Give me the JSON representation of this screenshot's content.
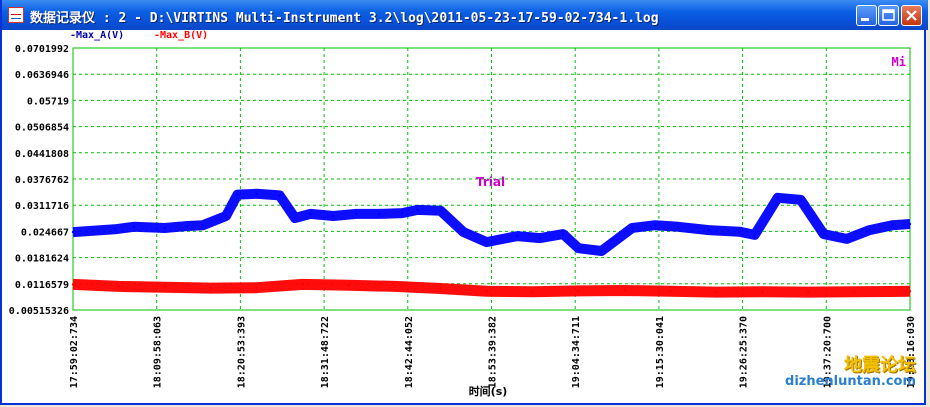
{
  "window": {
    "title": "数据记录仪 : 2 - D:\\VIRTINS Multi-Instrument 3.2\\log\\2011-05-23-17-59-02-734-1.log",
    "controls": [
      "minimize",
      "maximize",
      "close"
    ]
  },
  "legend": {
    "series_a": "-Max_A(V)",
    "series_b": "-Max_B(V)"
  },
  "plot": {
    "corner_label": "Mi",
    "trial_label": "Trial",
    "xlabel": "时间(s)",
    "background": "#ffffff",
    "grid_color": "#00c000",
    "series_a_color": "#0000ff",
    "series_b_color": "#ff0000"
  },
  "watermark": {
    "text": "地震论坛",
    "url": "dizhenluntan.com"
  },
  "chart_data": {
    "type": "line",
    "xlabel": "时间(s)",
    "ylabel": "",
    "grid": true,
    "legend_position": "top-left",
    "y_ticks": [
      "0.0701992",
      "0.0636946",
      "0.05719",
      "0.0506854",
      "0.0441808",
      "0.0376762",
      "0.0311716",
      "0.024667",
      "0.0181624",
      "0.0116579",
      "0.00515326"
    ],
    "x_ticks": [
      "17:59:02:734",
      "18:09:58:063",
      "18:20:53:393",
      "18:31:48:722",
      "18:42:44:052",
      "18:53:39:382",
      "19:04:34:711",
      "19:15:30:041",
      "19:26:25:370",
      "19:37:20:700",
      "19:48:16:030"
    ],
    "ylim": [
      0.00515326,
      0.0701992
    ],
    "x_range": [
      "17:59:02:734",
      "19:48:16:030"
    ],
    "series": [
      {
        "name": "-Max_A(V)",
        "color": "#0000ff",
        "x": [
          "17:59:02",
          "18:04:30",
          "18:07:00",
          "18:11:00",
          "18:14:00",
          "18:16:00",
          "18:19:00",
          "18:20:30",
          "18:23:00",
          "18:26:00",
          "18:28:00",
          "18:30:00",
          "18:33:00",
          "18:36:00",
          "18:39:00",
          "18:42:00",
          "18:44:00",
          "18:47:00",
          "18:50:00",
          "18:53:00",
          "18:57:00",
          "19:00:00",
          "19:03:00",
          "19:05:00",
          "19:08:00",
          "19:12:00",
          "19:15:00",
          "19:18:00",
          "19:22:00",
          "19:26:00",
          "19:28:00",
          "19:31:00",
          "19:34:00",
          "19:37:00",
          "19:40:00",
          "19:43:00",
          "19:46:00",
          "19:48:16"
        ],
        "values": [
          0.0245,
          0.0252,
          0.0258,
          0.0255,
          0.026,
          0.0262,
          0.0285,
          0.0338,
          0.034,
          0.0336,
          0.028,
          0.029,
          0.0285,
          0.029,
          0.029,
          0.0292,
          0.03,
          0.0298,
          0.0245,
          0.022,
          0.0235,
          0.023,
          0.024,
          0.0205,
          0.0198,
          0.0255,
          0.0262,
          0.0258,
          0.025,
          0.0246,
          0.0238,
          0.033,
          0.0325,
          0.024,
          0.0228,
          0.025,
          0.0262,
          0.0265
        ]
      },
      {
        "name": "-Max_B(V)",
        "color": "#ff0000",
        "x": [
          "17:59:02",
          "18:05:00",
          "18:11:00",
          "18:17:00",
          "18:23:00",
          "18:29:00",
          "18:35:00",
          "18:41:00",
          "18:47:00",
          "18:53:00",
          "18:59:00",
          "19:05:00",
          "19:11:00",
          "19:17:00",
          "19:23:00",
          "19:29:00",
          "19:35:00",
          "19:41:00",
          "19:48:16"
        ],
        "values": [
          0.0115,
          0.011,
          0.0108,
          0.0106,
          0.0107,
          0.0115,
          0.0113,
          0.011,
          0.0105,
          0.0098,
          0.0097,
          0.0099,
          0.01,
          0.0098,
          0.0096,
          0.0097,
          0.0096,
          0.0097,
          0.0098
        ]
      }
    ]
  }
}
